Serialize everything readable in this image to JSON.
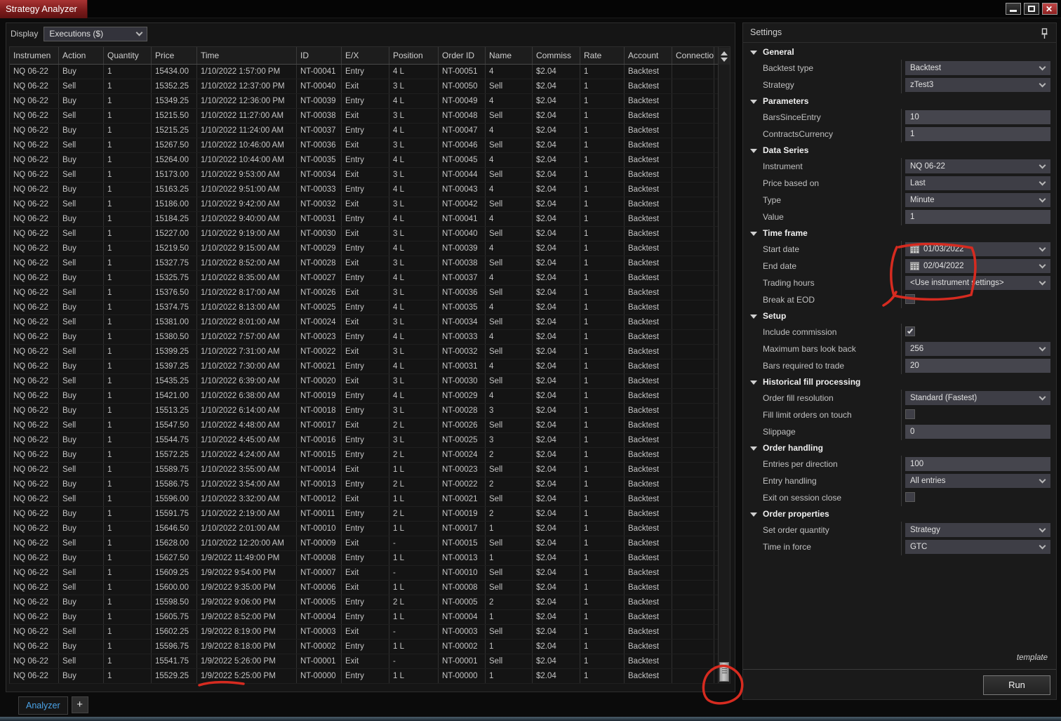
{
  "title_bar": {
    "title": "Strategy Analyzer"
  },
  "toolbar": {
    "display_label": "Display",
    "display_value": "Executions ($)"
  },
  "table": {
    "columns": [
      "Instrumen",
      "Action",
      "Quantity",
      "Price",
      "Time",
      "ID",
      "E/X",
      "Position",
      "Order ID",
      "Name",
      "Commiss",
      "Rate",
      "Account",
      "Connectio"
    ],
    "rows": [
      [
        "NQ 06-22",
        "Buy",
        "1",
        "15434.00",
        "1/10/2022 1:57:00 PM",
        "NT-00041",
        "Entry",
        "4 L",
        "NT-00051",
        "4",
        "$2.04",
        "1",
        "Backtest",
        ""
      ],
      [
        "NQ 06-22",
        "Sell",
        "1",
        "15352.25",
        "1/10/2022 12:37:00 PM",
        "NT-00040",
        "Exit",
        "3 L",
        "NT-00050",
        "Sell",
        "$2.04",
        "1",
        "Backtest",
        ""
      ],
      [
        "NQ 06-22",
        "Buy",
        "1",
        "15349.25",
        "1/10/2022 12:36:00 PM",
        "NT-00039",
        "Entry",
        "4 L",
        "NT-00049",
        "4",
        "$2.04",
        "1",
        "Backtest",
        ""
      ],
      [
        "NQ 06-22",
        "Sell",
        "1",
        "15215.50",
        "1/10/2022 11:27:00 AM",
        "NT-00038",
        "Exit",
        "3 L",
        "NT-00048",
        "Sell",
        "$2.04",
        "1",
        "Backtest",
        ""
      ],
      [
        "NQ 06-22",
        "Buy",
        "1",
        "15215.25",
        "1/10/2022 11:24:00 AM",
        "NT-00037",
        "Entry",
        "4 L",
        "NT-00047",
        "4",
        "$2.04",
        "1",
        "Backtest",
        ""
      ],
      [
        "NQ 06-22",
        "Sell",
        "1",
        "15267.50",
        "1/10/2022 10:46:00 AM",
        "NT-00036",
        "Exit",
        "3 L",
        "NT-00046",
        "Sell",
        "$2.04",
        "1",
        "Backtest",
        ""
      ],
      [
        "NQ 06-22",
        "Buy",
        "1",
        "15264.00",
        "1/10/2022 10:44:00 AM",
        "NT-00035",
        "Entry",
        "4 L",
        "NT-00045",
        "4",
        "$2.04",
        "1",
        "Backtest",
        ""
      ],
      [
        "NQ 06-22",
        "Sell",
        "1",
        "15173.00",
        "1/10/2022 9:53:00 AM",
        "NT-00034",
        "Exit",
        "3 L",
        "NT-00044",
        "Sell",
        "$2.04",
        "1",
        "Backtest",
        ""
      ],
      [
        "NQ 06-22",
        "Buy",
        "1",
        "15163.25",
        "1/10/2022 9:51:00 AM",
        "NT-00033",
        "Entry",
        "4 L",
        "NT-00043",
        "4",
        "$2.04",
        "1",
        "Backtest",
        ""
      ],
      [
        "NQ 06-22",
        "Sell",
        "1",
        "15186.00",
        "1/10/2022 9:42:00 AM",
        "NT-00032",
        "Exit",
        "3 L",
        "NT-00042",
        "Sell",
        "$2.04",
        "1",
        "Backtest",
        ""
      ],
      [
        "NQ 06-22",
        "Buy",
        "1",
        "15184.25",
        "1/10/2022 9:40:00 AM",
        "NT-00031",
        "Entry",
        "4 L",
        "NT-00041",
        "4",
        "$2.04",
        "1",
        "Backtest",
        ""
      ],
      [
        "NQ 06-22",
        "Sell",
        "1",
        "15227.00",
        "1/10/2022 9:19:00 AM",
        "NT-00030",
        "Exit",
        "3 L",
        "NT-00040",
        "Sell",
        "$2.04",
        "1",
        "Backtest",
        ""
      ],
      [
        "NQ 06-22",
        "Buy",
        "1",
        "15219.50",
        "1/10/2022 9:15:00 AM",
        "NT-00029",
        "Entry",
        "4 L",
        "NT-00039",
        "4",
        "$2.04",
        "1",
        "Backtest",
        ""
      ],
      [
        "NQ 06-22",
        "Sell",
        "1",
        "15327.75",
        "1/10/2022 8:52:00 AM",
        "NT-00028",
        "Exit",
        "3 L",
        "NT-00038",
        "Sell",
        "$2.04",
        "1",
        "Backtest",
        ""
      ],
      [
        "NQ 06-22",
        "Buy",
        "1",
        "15325.75",
        "1/10/2022 8:35:00 AM",
        "NT-00027",
        "Entry",
        "4 L",
        "NT-00037",
        "4",
        "$2.04",
        "1",
        "Backtest",
        ""
      ],
      [
        "NQ 06-22",
        "Sell",
        "1",
        "15376.50",
        "1/10/2022 8:17:00 AM",
        "NT-00026",
        "Exit",
        "3 L",
        "NT-00036",
        "Sell",
        "$2.04",
        "1",
        "Backtest",
        ""
      ],
      [
        "NQ 06-22",
        "Buy",
        "1",
        "15374.75",
        "1/10/2022 8:13:00 AM",
        "NT-00025",
        "Entry",
        "4 L",
        "NT-00035",
        "4",
        "$2.04",
        "1",
        "Backtest",
        ""
      ],
      [
        "NQ 06-22",
        "Sell",
        "1",
        "15381.00",
        "1/10/2022 8:01:00 AM",
        "NT-00024",
        "Exit",
        "3 L",
        "NT-00034",
        "Sell",
        "$2.04",
        "1",
        "Backtest",
        ""
      ],
      [
        "NQ 06-22",
        "Buy",
        "1",
        "15380.50",
        "1/10/2022 7:57:00 AM",
        "NT-00023",
        "Entry",
        "4 L",
        "NT-00033",
        "4",
        "$2.04",
        "1",
        "Backtest",
        ""
      ],
      [
        "NQ 06-22",
        "Sell",
        "1",
        "15399.25",
        "1/10/2022 7:31:00 AM",
        "NT-00022",
        "Exit",
        "3 L",
        "NT-00032",
        "Sell",
        "$2.04",
        "1",
        "Backtest",
        ""
      ],
      [
        "NQ 06-22",
        "Buy",
        "1",
        "15397.25",
        "1/10/2022 7:30:00 AM",
        "NT-00021",
        "Entry",
        "4 L",
        "NT-00031",
        "4",
        "$2.04",
        "1",
        "Backtest",
        ""
      ],
      [
        "NQ 06-22",
        "Sell",
        "1",
        "15435.25",
        "1/10/2022 6:39:00 AM",
        "NT-00020",
        "Exit",
        "3 L",
        "NT-00030",
        "Sell",
        "$2.04",
        "1",
        "Backtest",
        ""
      ],
      [
        "NQ 06-22",
        "Buy",
        "1",
        "15421.00",
        "1/10/2022 6:38:00 AM",
        "NT-00019",
        "Entry",
        "4 L",
        "NT-00029",
        "4",
        "$2.04",
        "1",
        "Backtest",
        ""
      ],
      [
        "NQ 06-22",
        "Buy",
        "1",
        "15513.25",
        "1/10/2022 6:14:00 AM",
        "NT-00018",
        "Entry",
        "3 L",
        "NT-00028",
        "3",
        "$2.04",
        "1",
        "Backtest",
        ""
      ],
      [
        "NQ 06-22",
        "Sell",
        "1",
        "15547.50",
        "1/10/2022 4:48:00 AM",
        "NT-00017",
        "Exit",
        "2 L",
        "NT-00026",
        "Sell",
        "$2.04",
        "1",
        "Backtest",
        ""
      ],
      [
        "NQ 06-22",
        "Buy",
        "1",
        "15544.75",
        "1/10/2022 4:45:00 AM",
        "NT-00016",
        "Entry",
        "3 L",
        "NT-00025",
        "3",
        "$2.04",
        "1",
        "Backtest",
        ""
      ],
      [
        "NQ 06-22",
        "Buy",
        "1",
        "15572.25",
        "1/10/2022 4:24:00 AM",
        "NT-00015",
        "Entry",
        "2 L",
        "NT-00024",
        "2",
        "$2.04",
        "1",
        "Backtest",
        ""
      ],
      [
        "NQ 06-22",
        "Sell",
        "1",
        "15589.75",
        "1/10/2022 3:55:00 AM",
        "NT-00014",
        "Exit",
        "1 L",
        "NT-00023",
        "Sell",
        "$2.04",
        "1",
        "Backtest",
        ""
      ],
      [
        "NQ 06-22",
        "Buy",
        "1",
        "15586.75",
        "1/10/2022 3:54:00 AM",
        "NT-00013",
        "Entry",
        "2 L",
        "NT-00022",
        "2",
        "$2.04",
        "1",
        "Backtest",
        ""
      ],
      [
        "NQ 06-22",
        "Sell",
        "1",
        "15596.00",
        "1/10/2022 3:32:00 AM",
        "NT-00012",
        "Exit",
        "1 L",
        "NT-00021",
        "Sell",
        "$2.04",
        "1",
        "Backtest",
        ""
      ],
      [
        "NQ 06-22",
        "Buy",
        "1",
        "15591.75",
        "1/10/2022 2:19:00 AM",
        "NT-00011",
        "Entry",
        "2 L",
        "NT-00019",
        "2",
        "$2.04",
        "1",
        "Backtest",
        ""
      ],
      [
        "NQ 06-22",
        "Buy",
        "1",
        "15646.50",
        "1/10/2022 2:01:00 AM",
        "NT-00010",
        "Entry",
        "1 L",
        "NT-00017",
        "1",
        "$2.04",
        "1",
        "Backtest",
        ""
      ],
      [
        "NQ 06-22",
        "Sell",
        "1",
        "15628.00",
        "1/10/2022 12:20:00 AM",
        "NT-00009",
        "Exit",
        "-",
        "NT-00015",
        "Sell",
        "$2.04",
        "1",
        "Backtest",
        ""
      ],
      [
        "NQ 06-22",
        "Buy",
        "1",
        "15627.50",
        "1/9/2022 11:49:00 PM",
        "NT-00008",
        "Entry",
        "1 L",
        "NT-00013",
        "1",
        "$2.04",
        "1",
        "Backtest",
        ""
      ],
      [
        "NQ 06-22",
        "Sell",
        "1",
        "15609.25",
        "1/9/2022 9:54:00 PM",
        "NT-00007",
        "Exit",
        "-",
        "NT-00010",
        "Sell",
        "$2.04",
        "1",
        "Backtest",
        ""
      ],
      [
        "NQ 06-22",
        "Sell",
        "1",
        "15600.00",
        "1/9/2022 9:35:00 PM",
        "NT-00006",
        "Exit",
        "1 L",
        "NT-00008",
        "Sell",
        "$2.04",
        "1",
        "Backtest",
        ""
      ],
      [
        "NQ 06-22",
        "Buy",
        "1",
        "15598.50",
        "1/9/2022 9:06:00 PM",
        "NT-00005",
        "Entry",
        "2 L",
        "NT-00005",
        "2",
        "$2.04",
        "1",
        "Backtest",
        ""
      ],
      [
        "NQ 06-22",
        "Buy",
        "1",
        "15605.75",
        "1/9/2022 8:52:00 PM",
        "NT-00004",
        "Entry",
        "1 L",
        "NT-00004",
        "1",
        "$2.04",
        "1",
        "Backtest",
        ""
      ],
      [
        "NQ 06-22",
        "Sell",
        "1",
        "15602.25",
        "1/9/2022 8:19:00 PM",
        "NT-00003",
        "Exit",
        "-",
        "NT-00003",
        "Sell",
        "$2.04",
        "1",
        "Backtest",
        ""
      ],
      [
        "NQ 06-22",
        "Buy",
        "1",
        "15596.75",
        "1/9/2022 8:18:00 PM",
        "NT-00002",
        "Entry",
        "1 L",
        "NT-00002",
        "1",
        "$2.04",
        "1",
        "Backtest",
        ""
      ],
      [
        "NQ 06-22",
        "Sell",
        "1",
        "15541.75",
        "1/9/2022 5:26:00 PM",
        "NT-00001",
        "Exit",
        "-",
        "NT-00001",
        "Sell",
        "$2.04",
        "1",
        "Backtest",
        ""
      ],
      [
        "NQ 06-22",
        "Buy",
        "1",
        "15529.25",
        "1/9/2022 5:25:00 PM",
        "NT-00000",
        "Entry",
        "1 L",
        "NT-00000",
        "1",
        "$2.04",
        "1",
        "Backtest",
        ""
      ]
    ]
  },
  "settings": {
    "title": "Settings",
    "sections": [
      {
        "label": "General",
        "items": [
          {
            "label": "Backtest type",
            "type": "dropdown",
            "value": "Backtest"
          },
          {
            "label": "Strategy",
            "type": "dropdown",
            "value": "zTest3"
          }
        ]
      },
      {
        "label": "Parameters",
        "items": [
          {
            "label": "BarsSinceEntry",
            "type": "input",
            "value": "10"
          },
          {
            "label": "ContractsCurrency",
            "type": "input",
            "value": "1"
          }
        ]
      },
      {
        "label": "Data Series",
        "items": [
          {
            "label": "Instrument",
            "type": "dropdown",
            "value": "NQ 06-22"
          },
          {
            "label": "Price based on",
            "type": "dropdown",
            "value": "Last"
          },
          {
            "label": "Type",
            "type": "dropdown",
            "value": "Minute"
          },
          {
            "label": "Value",
            "type": "input",
            "value": "1"
          }
        ]
      },
      {
        "label": "Time frame",
        "items": [
          {
            "label": "Start date",
            "type": "date",
            "value": "01/03/2022"
          },
          {
            "label": "End date",
            "type": "date",
            "value": "02/04/2022"
          },
          {
            "label": "Trading hours",
            "type": "dropdown",
            "value": "<Use instrument settings>"
          },
          {
            "label": "Break at EOD",
            "type": "checkbox",
            "checked": false
          }
        ]
      },
      {
        "label": "Setup",
        "items": [
          {
            "label": "Include commission",
            "type": "checkbox",
            "checked": true
          },
          {
            "label": "Maximum bars look back",
            "type": "dropdown",
            "value": "256"
          },
          {
            "label": "Bars required to trade",
            "type": "input",
            "value": "20"
          }
        ]
      },
      {
        "label": "Historical fill processing",
        "items": [
          {
            "label": "Order fill resolution",
            "type": "dropdown",
            "value": "Standard (Fastest)"
          },
          {
            "label": "Fill limit orders on touch",
            "type": "checkbox",
            "checked": false
          },
          {
            "label": "Slippage",
            "type": "input",
            "value": "0"
          }
        ]
      },
      {
        "label": "Order handling",
        "items": [
          {
            "label": "Entries per direction",
            "type": "input",
            "value": "100"
          },
          {
            "label": "Entry handling",
            "type": "dropdown",
            "value": "All entries"
          },
          {
            "label": "Exit on session close",
            "type": "checkbox",
            "checked": false
          }
        ]
      },
      {
        "label": "Order properties",
        "items": [
          {
            "label": "Set order quantity",
            "type": "dropdown",
            "value": "Strategy"
          },
          {
            "label": "Time in force",
            "type": "dropdown",
            "value": "GTC"
          }
        ]
      }
    ],
    "template_label": "template",
    "run_label": "Run"
  },
  "tabs": {
    "analyzer_label": "Analyzer",
    "add_label": "+"
  },
  "annotation_color": "#d62b20"
}
